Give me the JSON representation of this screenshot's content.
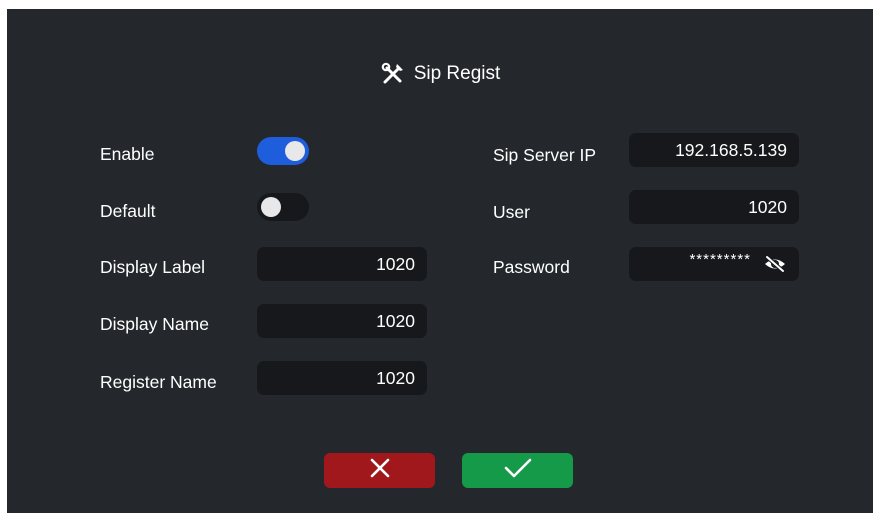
{
  "header": {
    "title": "Sip Regist",
    "icon": "tools-icon"
  },
  "left_form": {
    "enable": {
      "label": "Enable",
      "on": true
    },
    "default": {
      "label": "Default",
      "on": false
    },
    "display_label": {
      "label": "Display Label",
      "value": "1020"
    },
    "display_name": {
      "label": "Display Name",
      "value": "1020"
    },
    "register_name": {
      "label": "Register Name",
      "value": "1020"
    }
  },
  "right_form": {
    "sip_server_ip": {
      "label": "Sip Server IP",
      "value": "192.168.5.139"
    },
    "user": {
      "label": "User",
      "value": "1020"
    },
    "password": {
      "label": "Password",
      "masked_value": "*********",
      "icon": "eye-off-icon"
    }
  },
  "actions": {
    "cancel_icon": "close-icon",
    "confirm_icon": "check-icon"
  },
  "colors": {
    "panel_bg": "#24272b",
    "field_bg": "#16181b",
    "toggle_on": "#1e5ddc",
    "cancel": "#a0171c",
    "confirm": "#149a48"
  }
}
